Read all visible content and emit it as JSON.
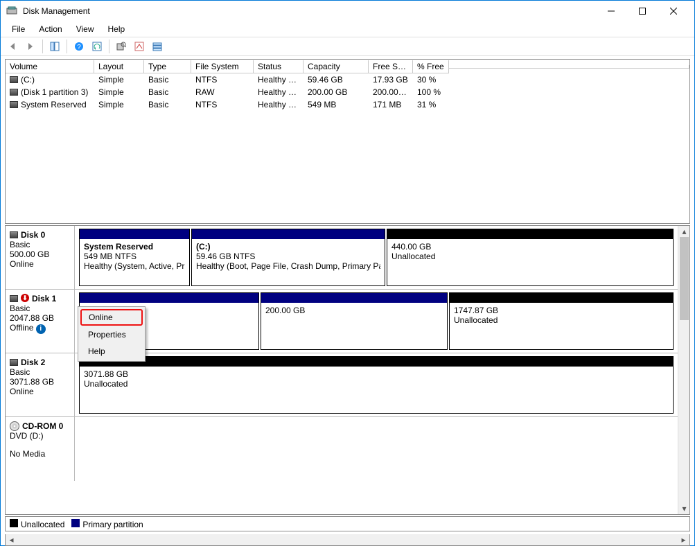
{
  "window": {
    "title": "Disk Management"
  },
  "menu": {
    "file": "File",
    "action": "Action",
    "view": "View",
    "help": "Help"
  },
  "columns": [
    "Volume",
    "Layout",
    "Type",
    "File System",
    "Status",
    "Capacity",
    "Free Spa...",
    "% Free"
  ],
  "volumes": [
    {
      "name": "(C:)",
      "layout": "Simple",
      "type": "Basic",
      "fs": "NTFS",
      "status": "Healthy (B...",
      "capacity": "59.46 GB",
      "free": "17.93 GB",
      "pct": "30 %"
    },
    {
      "name": "(Disk 1 partition 3)",
      "layout": "Simple",
      "type": "Basic",
      "fs": "RAW",
      "status": "Healthy (P...",
      "capacity": "200.00 GB",
      "free": "200.00 GB",
      "pct": "100 %"
    },
    {
      "name": "System Reserved",
      "layout": "Simple",
      "type": "Basic",
      "fs": "NTFS",
      "status": "Healthy (S...",
      "capacity": "549 MB",
      "free": "171 MB",
      "pct": "31 %"
    }
  ],
  "disks": {
    "d0": {
      "title": "Disk 0",
      "kind": "Basic",
      "size": "500.00 GB",
      "state": "Online",
      "parts": [
        {
          "stripe": "navy",
          "name": "System Reserved",
          "l1": "549 MB NTFS",
          "l2": "Healthy (System, Active, Pr"
        },
        {
          "stripe": "navy",
          "name": "(C:)",
          "l1": "59.46 GB NTFS",
          "l2": "Healthy (Boot, Page File, Crash Dump, Primary Pa"
        },
        {
          "stripe": "black",
          "name": "",
          "l1": "440.00 GB",
          "l2": "Unallocated"
        }
      ]
    },
    "d1": {
      "title": "Disk 1",
      "kind": "Basic",
      "size": "2047.88 GB",
      "state": "Offline",
      "parts": [
        {
          "stripe": "navy",
          "name": "",
          "l1": "",
          "l2": ""
        },
        {
          "stripe": "navy",
          "name": "",
          "l1": "200.00 GB",
          "l2": ""
        },
        {
          "stripe": "black",
          "name": "",
          "l1": "1747.87 GB",
          "l2": "Unallocated"
        }
      ]
    },
    "d2": {
      "title": "Disk 2",
      "kind": "Basic",
      "size": "3071.88 GB",
      "state": "Online",
      "parts": [
        {
          "stripe": "black",
          "name": "",
          "l1": "3071.88 GB",
          "l2": "Unallocated"
        }
      ]
    },
    "cd": {
      "title": "CD-ROM 0",
      "kind": "DVD (D:)",
      "nomedia": "No Media"
    }
  },
  "legend": {
    "unalloc": "Unallocated",
    "primary": "Primary partition"
  },
  "context": {
    "online": "Online",
    "properties": "Properties",
    "help": "Help"
  },
  "info_i": "i"
}
